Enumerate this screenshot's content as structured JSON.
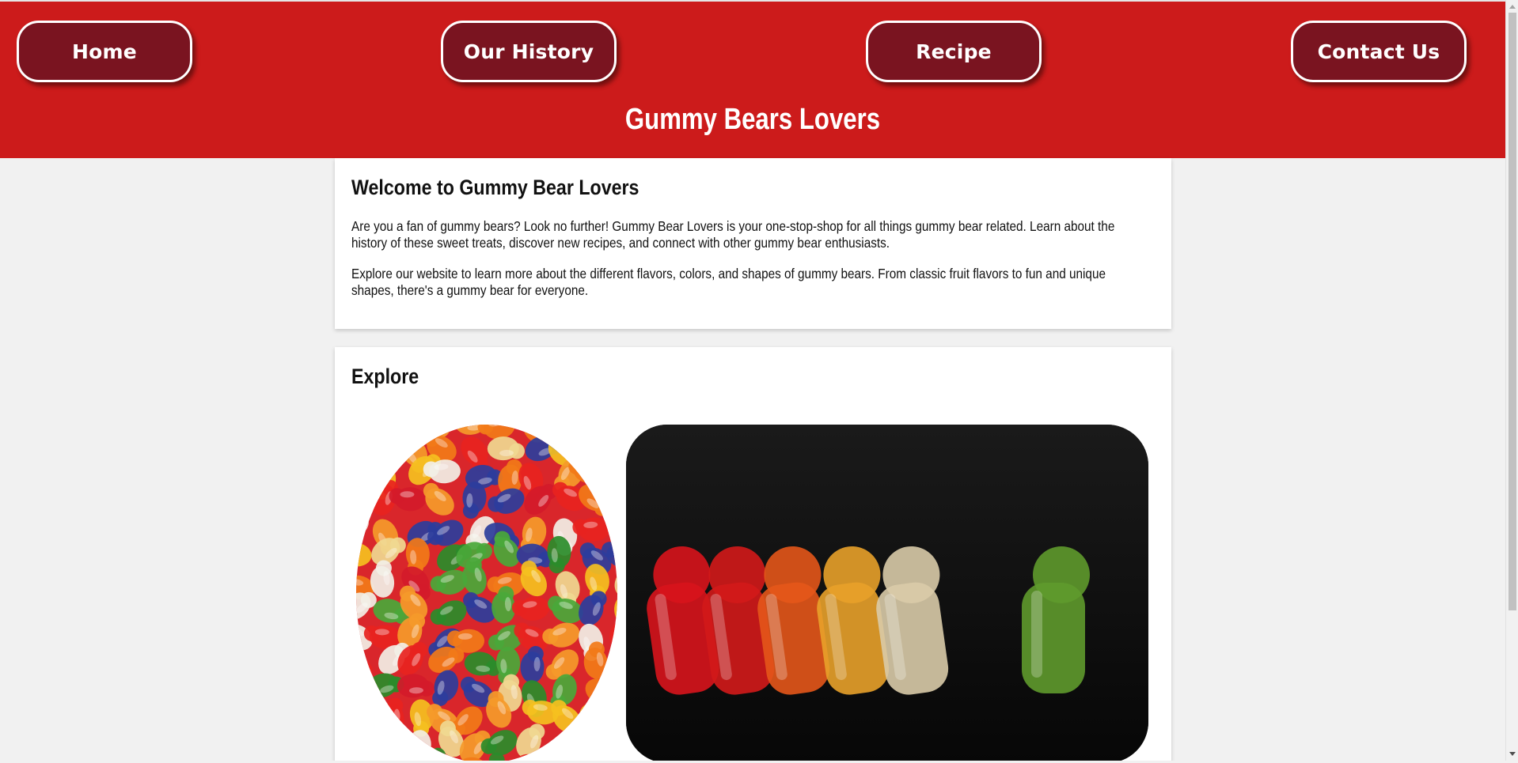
{
  "nav": {
    "items": [
      {
        "label": "Home"
      },
      {
        "label": "Our History"
      },
      {
        "label": "Recipe"
      },
      {
        "label": "Contact Us"
      }
    ]
  },
  "header": {
    "title": "Gummy Bears Lovers"
  },
  "welcome": {
    "heading": "Welcome to Gummy Bear Lovers",
    "paragraph1": "Are you a fan of gummy bears? Look no further! Gummy Bear Lovers is your one-stop-shop for all things gummy bear related. Learn about the history of these sweet treats, discover new recipes, and connect with other gummy bear enthusiasts.",
    "paragraph2": "Explore our website to learn more about the different flavors, colors, and shapes of gummy bears. From classic fruit flavors to fun and unique shapes, there's a gummy bear for everyone."
  },
  "explore": {
    "heading": "Explore"
  },
  "colors": {
    "header_bg": "#cc1b1b",
    "nav_button_bg": "#7a1420",
    "page_bg": "#f1f1f1"
  }
}
